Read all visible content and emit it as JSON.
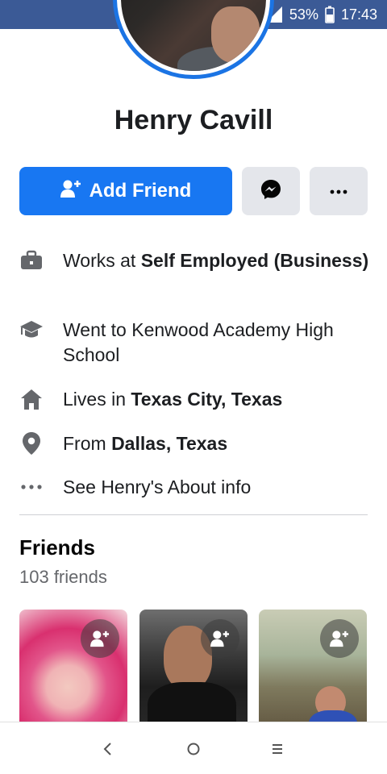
{
  "status_bar": {
    "battery": "53%",
    "time": "17:43",
    "icons": [
      "vibrate-icon",
      "wifi-icon",
      "signal-icon",
      "battery-icon"
    ]
  },
  "profile": {
    "name": "Henry Cavill"
  },
  "actions": {
    "add_friend_label": "Add Friend",
    "accent_color": "#1877f2"
  },
  "info": {
    "work_prefix": "Works at ",
    "work_value": "Self Employed (Business)",
    "education": "Went to Kenwood Academy High School",
    "lives_prefix": "Lives in ",
    "lives_value": "Texas City, Texas",
    "from_prefix": "From ",
    "from_value": "Dallas, Texas",
    "about_link": "See Henry's About info"
  },
  "friends": {
    "title": "Friends",
    "count": "103 friends"
  },
  "nav": {
    "back": "‹",
    "home": "○",
    "recents": "≡"
  }
}
